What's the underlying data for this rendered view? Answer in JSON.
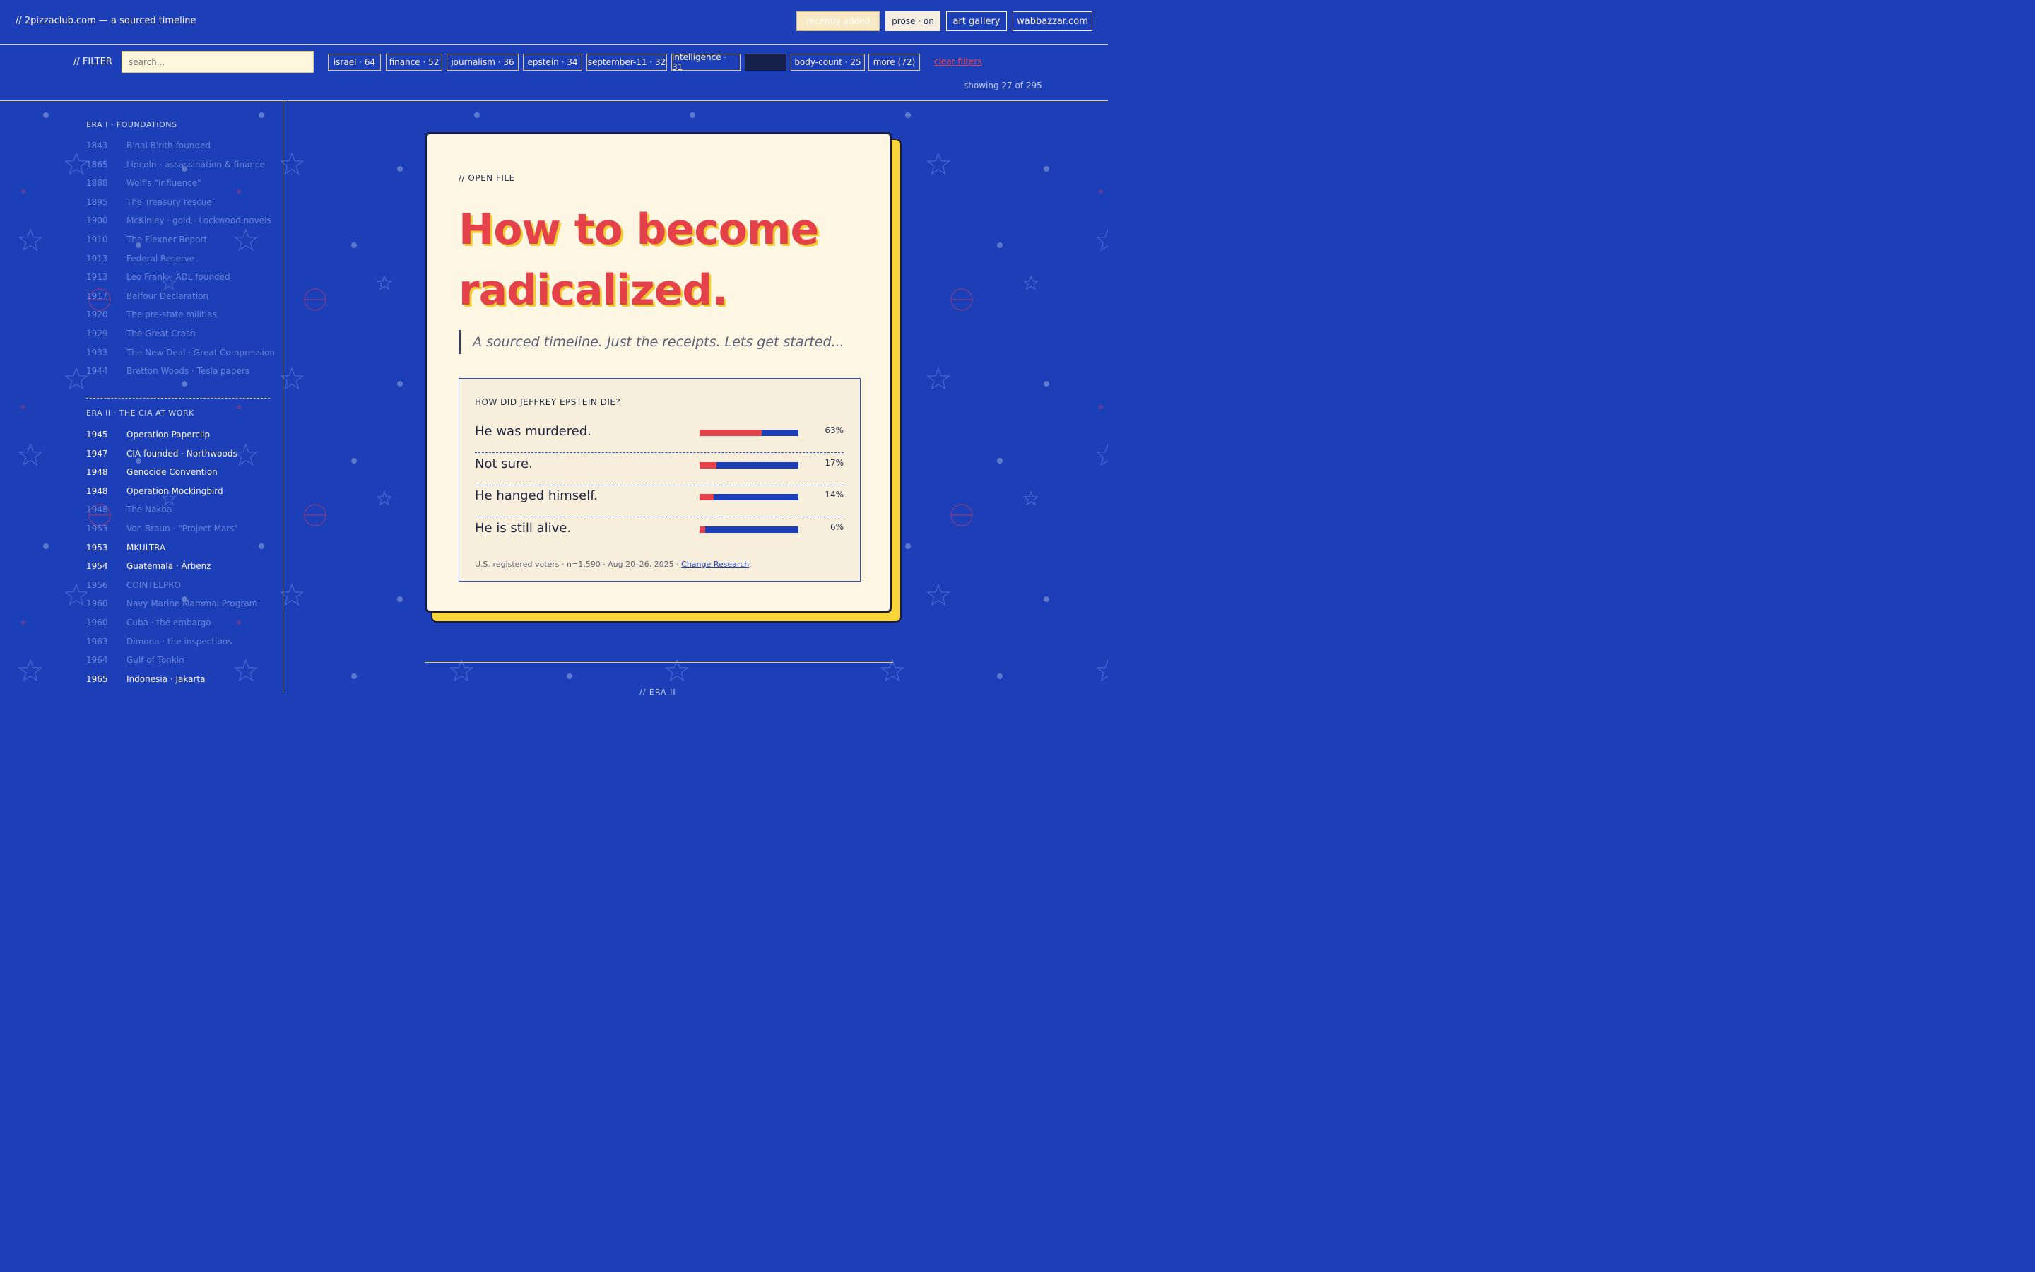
{
  "header": {
    "site_title": "// 2pizzaclub.com — a sourced timeline",
    "nav": {
      "recently_added": "recently added",
      "prose": "prose · on",
      "art_gallery": "art gallery",
      "wabbazzar": "wabbazzar.com"
    }
  },
  "filter": {
    "label": "// FILTER",
    "search_placeholder": "search...",
    "chips": [
      {
        "label": "israel · 64"
      },
      {
        "label": "finance · 52"
      },
      {
        "label": "journalism · 36"
      },
      {
        "label": "epstein · 34"
      },
      {
        "label": "september-11 · 32"
      },
      {
        "label": "intelligence · 31"
      },
      {
        "label": ""
      },
      {
        "label": "body-count · 25"
      },
      {
        "label": "more (72)"
      }
    ],
    "clear_label": "clear filters",
    "showing": "showing 27 of 295"
  },
  "sidebar": {
    "era1": "ERA I · FOUNDATIONS",
    "era1_items": [
      {
        "year": "1843",
        "title": "B'nai B'rith founded"
      },
      {
        "year": "1865",
        "title": "Lincoln · assassination & finance"
      },
      {
        "year": "1888",
        "title": "Wolf's \"Influence\""
      },
      {
        "year": "1895",
        "title": "The Treasury rescue"
      },
      {
        "year": "1900",
        "title": "McKinley · gold · Lockwood novels"
      },
      {
        "year": "1910",
        "title": "The Flexner Report"
      },
      {
        "year": "1913",
        "title": "Federal Reserve"
      },
      {
        "year": "1913",
        "title": "Leo Frank · ADL founded"
      },
      {
        "year": "1917",
        "title": "Balfour Declaration"
      },
      {
        "year": "1920",
        "title": "The pre-state militias"
      },
      {
        "year": "1929",
        "title": "The Great Crash"
      },
      {
        "year": "1933",
        "title": "The New Deal · Great Compression"
      },
      {
        "year": "1944",
        "title": "Bretton Woods · Tesla papers"
      }
    ],
    "era2": "ERA II · THE CIA AT WORK",
    "era2_items": [
      {
        "year": "1945",
        "title": "Operation Paperclip",
        "lit": true
      },
      {
        "year": "1947",
        "title": "CIA founded · Northwoods",
        "lit": true
      },
      {
        "year": "1948",
        "title": "Genocide Convention",
        "lit": true
      },
      {
        "year": "1948",
        "title": "Operation Mockingbird",
        "lit": true
      },
      {
        "year": "1948",
        "title": "The Nakba",
        "lit": false
      },
      {
        "year": "1953",
        "title": "Von Braun · \"Project Mars\"",
        "lit": false
      },
      {
        "year": "1953",
        "title": "MKULTRA",
        "lit": true
      },
      {
        "year": "1954",
        "title": "Guatemala · Árbenz",
        "lit": true
      },
      {
        "year": "1956",
        "title": "COINTELPRO",
        "lit": false
      },
      {
        "year": "1960",
        "title": "Navy Marine Mammal Program",
        "lit": false
      },
      {
        "year": "1960",
        "title": "Cuba · the embargo",
        "lit": false
      },
      {
        "year": "1963",
        "title": "Dimona · the inspections",
        "lit": false
      },
      {
        "year": "1964",
        "title": "Gulf of Tonkin",
        "lit": false
      },
      {
        "year": "1965",
        "title": "Indonesia · Jakarta",
        "lit": true
      }
    ]
  },
  "card": {
    "open_file": "// OPEN FILE",
    "headline_line1": "How to become",
    "headline_line2": "radicalized.",
    "subtitle": "A sourced timeline. Just the receipts. Lets get started...",
    "poll": {
      "question": "HOW DID JEFFREY EPSTEIN DIE?",
      "answers": [
        {
          "text": "He was murdered.",
          "pct_label": "63%",
          "pct": 63
        },
        {
          "text": "Not sure.",
          "pct_label": "17%",
          "pct": 17
        },
        {
          "text": "He hanged himself.",
          "pct_label": "14%",
          "pct": 14
        },
        {
          "text": "He is still alive.",
          "pct_label": "6%",
          "pct": 6
        }
      ],
      "source_text": "U.S. registered voters · n=1,590 · Aug 20–26, 2025 · ",
      "source_link": "Change Research",
      "source_end": "."
    }
  },
  "footer": {
    "next_era": "// ERA II"
  },
  "colors": {
    "background": "#1c3fb7",
    "accent_red": "#e5414a",
    "accent_yellow": "#f7d53b",
    "card_bg": "#fdf6e3"
  }
}
